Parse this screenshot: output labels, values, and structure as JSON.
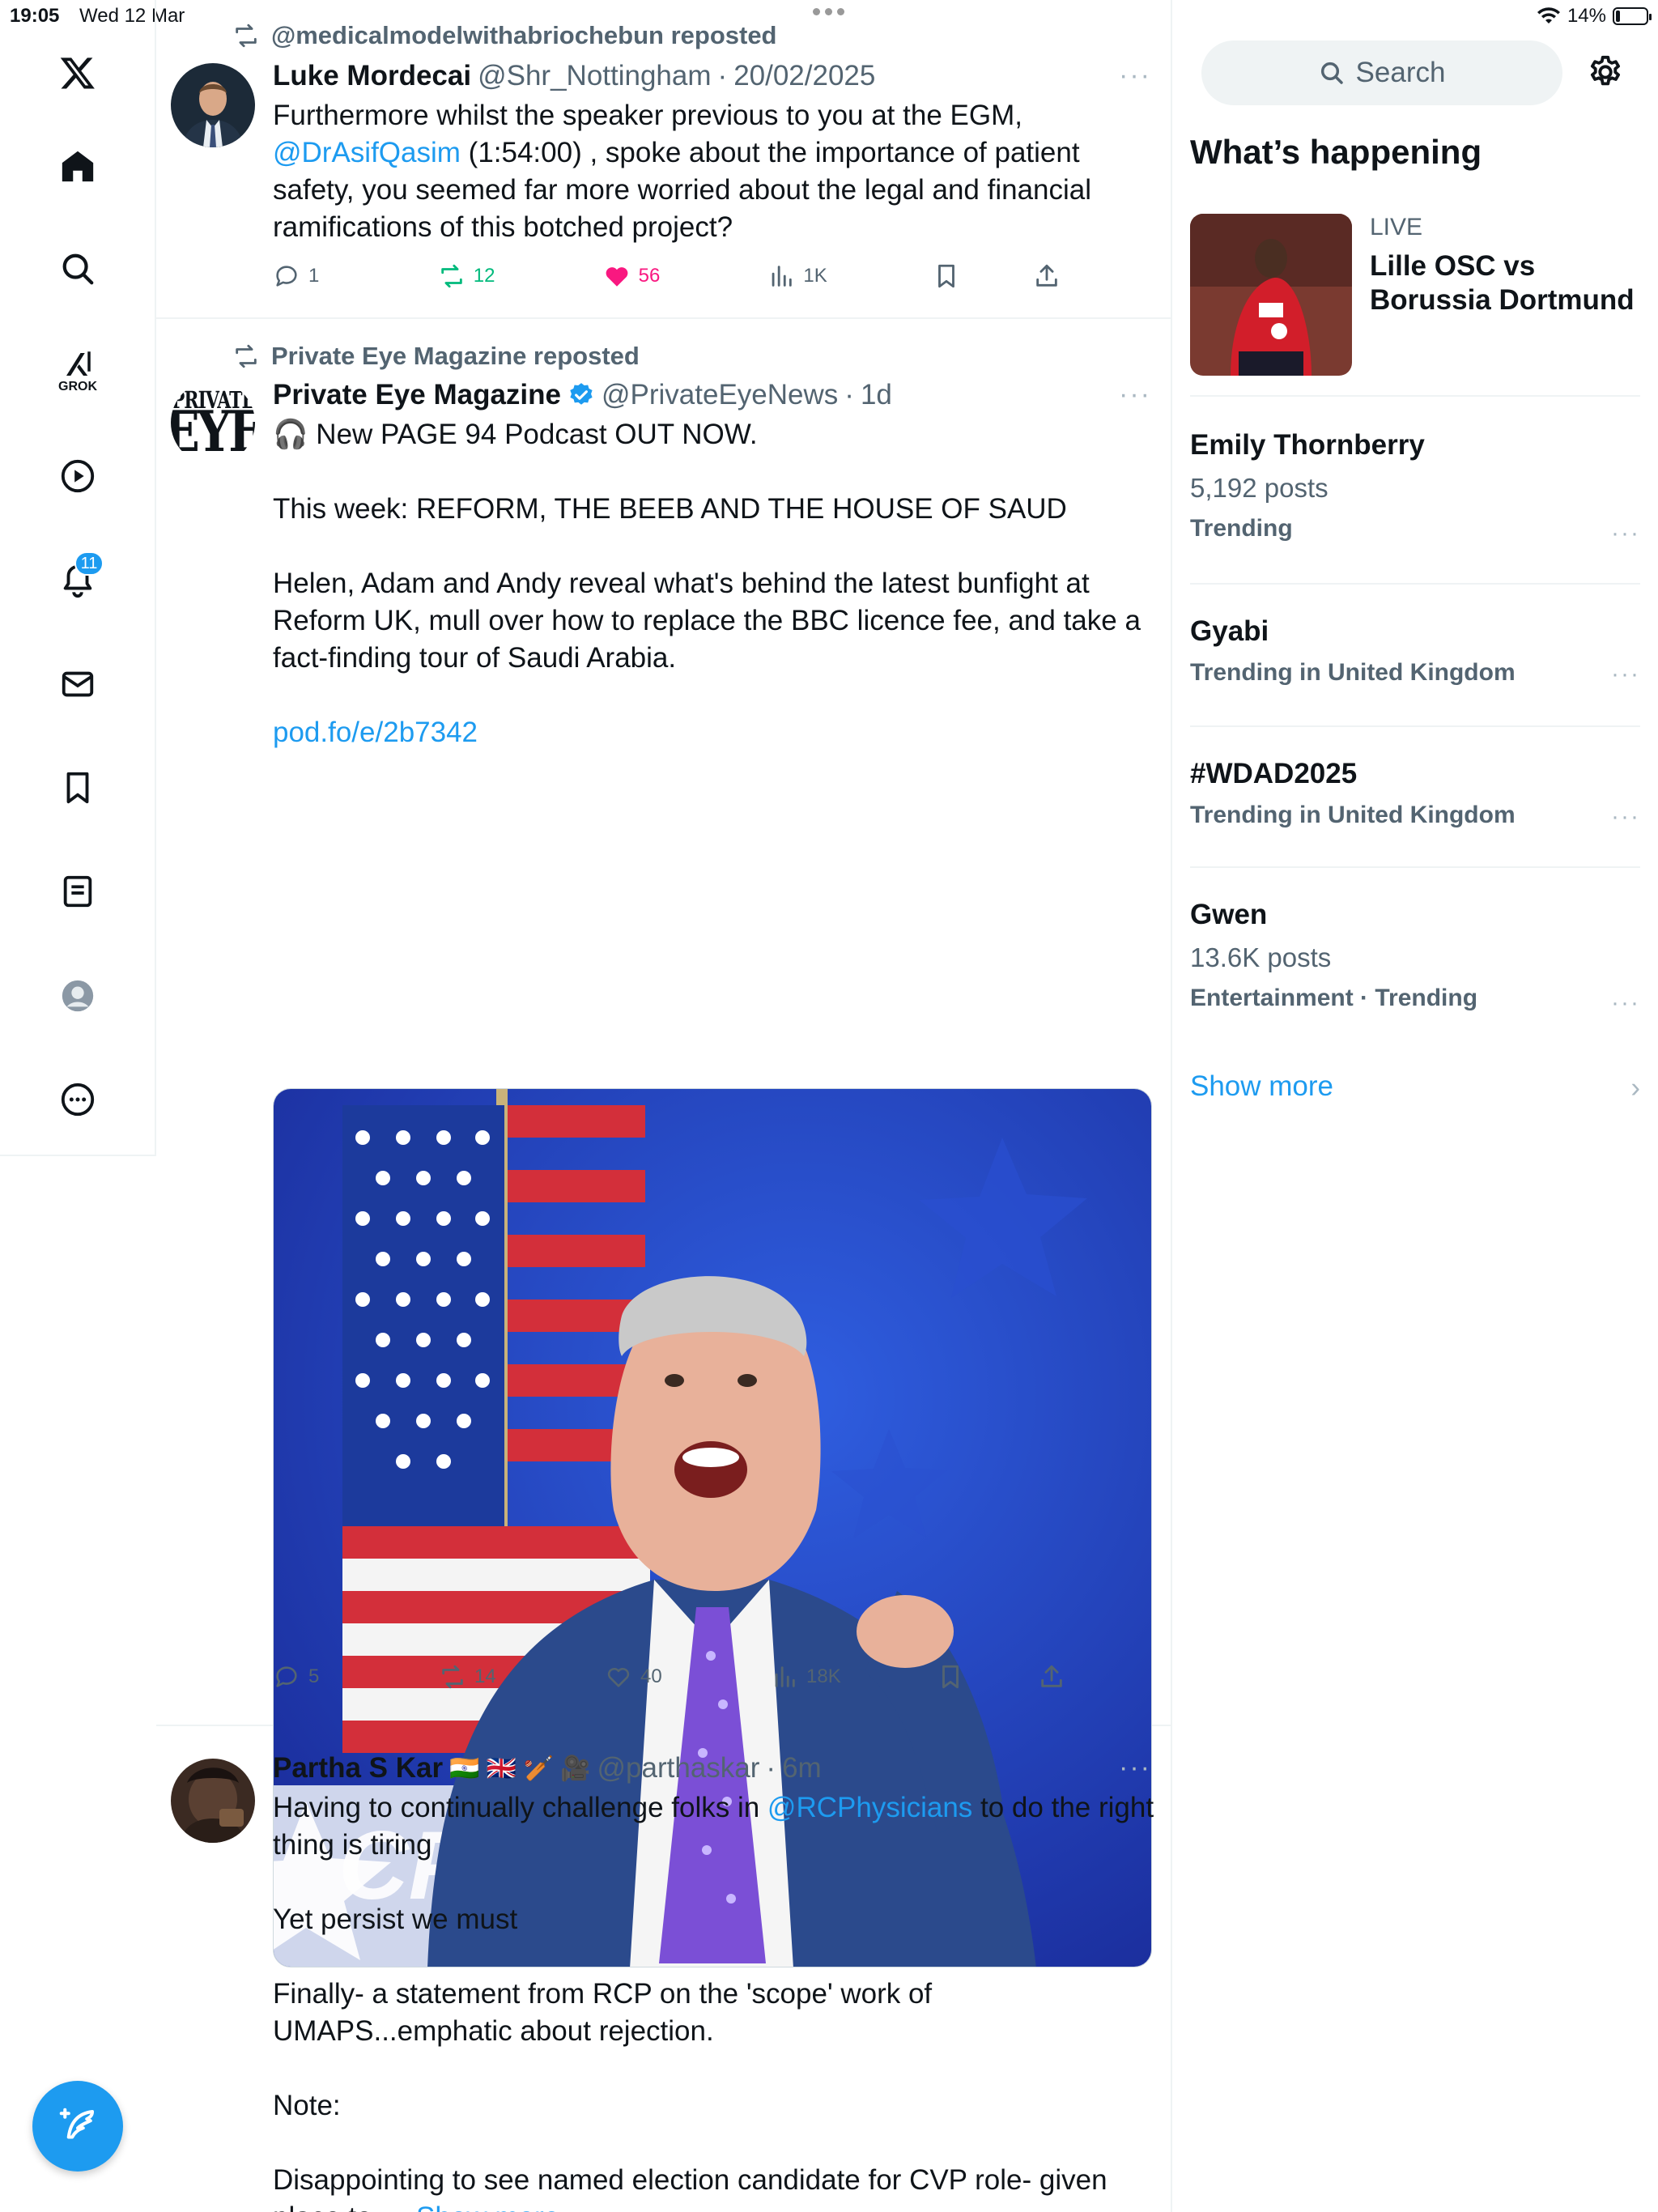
{
  "status_bar": {
    "time": "19:05",
    "date": "Wed 12 Mar",
    "battery": "14%",
    "battery_level": 0.14
  },
  "nav": {
    "logo": "x-logo-icon",
    "grok_label": "GROK",
    "notifications_badge": "11",
    "items": [
      "home-icon",
      "search-icon",
      "grok-icon",
      "video-icon",
      "notifications-icon",
      "messages-icon",
      "bookmarks-icon",
      "lists-icon",
      "profile-icon",
      "more-icon"
    ]
  },
  "posts": [
    {
      "repost_by": "@medicalmodelwithabriochebun reposted",
      "name": "Luke Mordecai",
      "handle": "@Shr_Nottingham",
      "time": "20/02/2025",
      "text_parts": [
        "Furthermore whilst the speaker previous to you at the EGM, ",
        "@DrAsifQasim",
        " (1:54:00) , spoke about the importance of patient safety, you seemed far more worried about the legal and financial ramifications of this botched project?"
      ],
      "replies": "1",
      "reposts": "12",
      "likes": "56",
      "views": "1K"
    },
    {
      "repost_by": "Private Eye Magazine reposted",
      "name": "Private Eye Magazine",
      "handle": "@PrivateEyeNews",
      "time": "1d",
      "avatar_text": [
        "PRIVATE",
        "EYE"
      ],
      "text": "🎧 New PAGE 94 Podcast OUT NOW.\n\nThis week: REFORM, THE BEEB AND THE HOUSE OF SAUD\n\nHelen, Adam and Andy reveal what's behind the latest bunfight at Reform UK, mull over how to replace the BBC licence fee, and take a fact-finding tour of Saudi Arabia.",
      "link": "pod.fo/e/2b7342",
      "media_logo": "CP",
      "replies": "5",
      "reposts": "14",
      "likes": "40",
      "views": "18K"
    },
    {
      "name": "Partha S Kar",
      "name_emojis": "🇮🇳 🇬🇧 🏏 🎥",
      "handle": "@parthaskar",
      "time": "6m",
      "text_parts": [
        "Having to continually challenge folks in ",
        "@RCPhysicians",
        " to do the right thing is tiring\n\nYet persist we must\n\nFinally- a statement from RCP on the 'scope' work of UMAPS...emphatic about rejection.\n\nNote:\n\nDisappointing to see named election candidate for CVP role- given place to…  "
      ],
      "show_more": "Show more"
    }
  ],
  "sidebar": {
    "search_placeholder": "Search",
    "title": "What’s happening",
    "live": {
      "tag": "LIVE",
      "title": "Lille OSC vs Borussia Dortmund"
    },
    "trends": [
      {
        "name": "Emily Thornberry",
        "count": "5,192 posts",
        "meta": "Trending"
      },
      {
        "name": "Gyabi",
        "count": "",
        "meta": "Trending in United Kingdom"
      },
      {
        "name": "#WDAD2025",
        "count": "",
        "meta": "Trending in United Kingdom"
      },
      {
        "name": "Gwen",
        "count": "13.6K posts",
        "meta": "Entertainment · Trending"
      }
    ],
    "show_more": "Show more"
  },
  "colors": {
    "accent": "#1d9bf0",
    "like": "#f91880",
    "repost": "#00ba7c",
    "muted": "#536471"
  }
}
